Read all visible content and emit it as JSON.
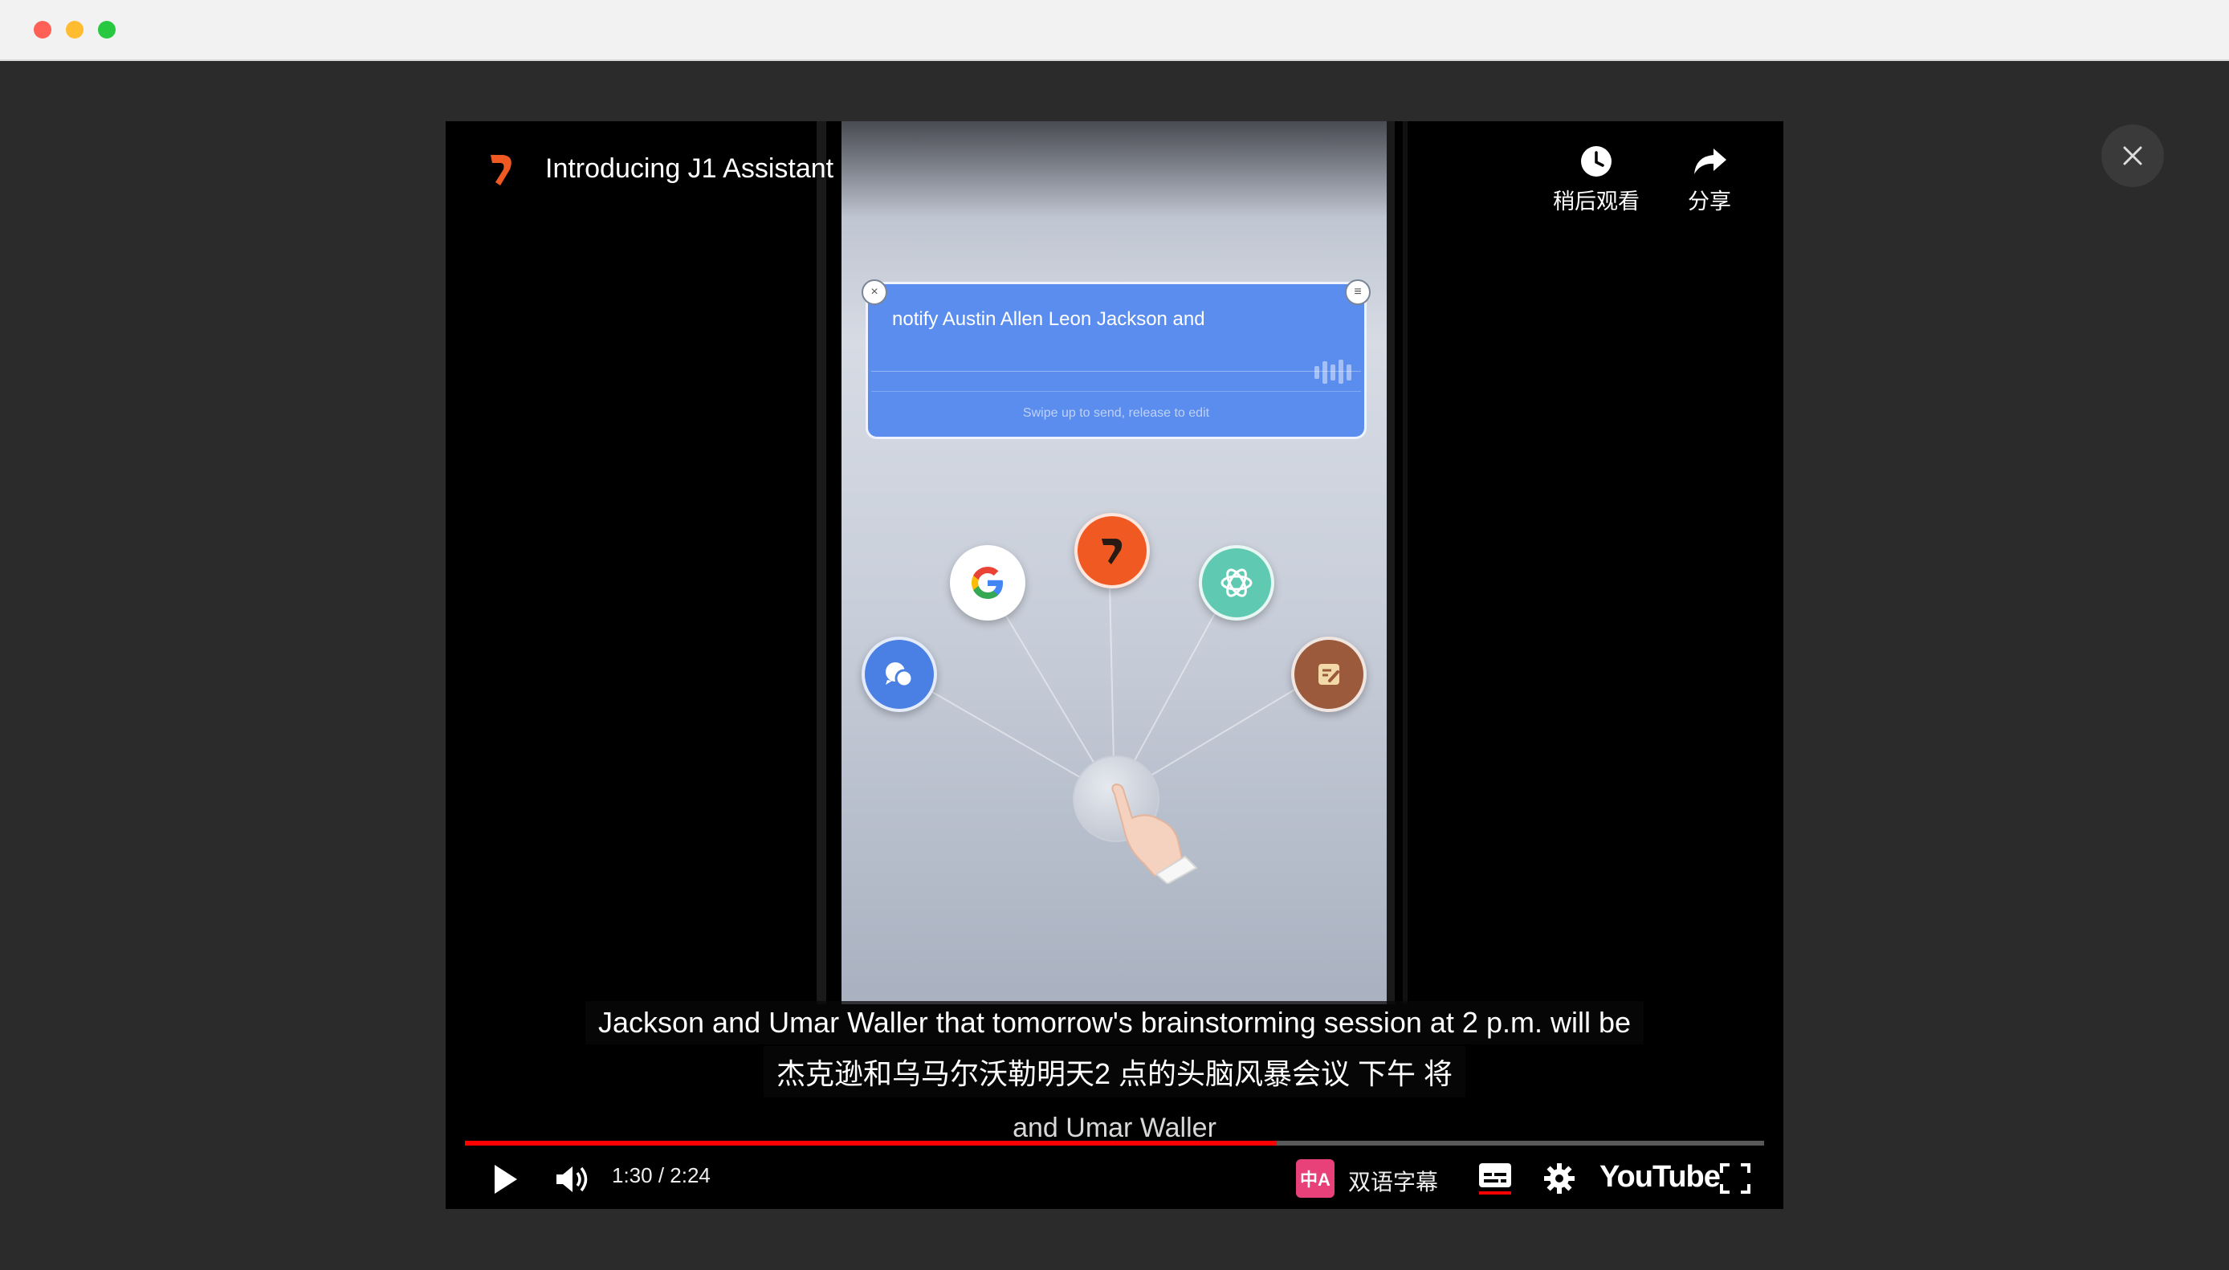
{
  "window": {
    "controls": [
      "close",
      "minimize",
      "maximize"
    ]
  },
  "overlay": {
    "close_icon": "close-icon"
  },
  "video": {
    "title": "Introducing J1 Assistant",
    "top_actions": {
      "watch_later_label": "稍后观看",
      "share_label": "分享"
    }
  },
  "phone_screen": {
    "voice_text": "notify Austin Allen Leon Jackson and",
    "voice_hint": "Swipe up to send, release to edit",
    "apps": [
      "google-icon",
      "j1-icon",
      "chatgpt-icon",
      "chat-icon",
      "notes-icon"
    ]
  },
  "captions": {
    "line1": "Jackson and Umar Waller that tomorrow's brainstorming session at 2 p.m. will be",
    "line2": "杰克逊和乌马尔沃勒明天2 点的头脑风暴会议 下午 将",
    "line3": "and Umar Waller"
  },
  "controls": {
    "time": "1:30 / 2:24",
    "progress_fraction": 0.625,
    "bilingual_subs_label": "双语字幕",
    "bilingual_icon_text": "中A",
    "youtube_label": "YouTube"
  },
  "colors": {
    "progress": "#ff0000",
    "j1_accent": "#f05a22",
    "voice_card": "#5b8def"
  }
}
